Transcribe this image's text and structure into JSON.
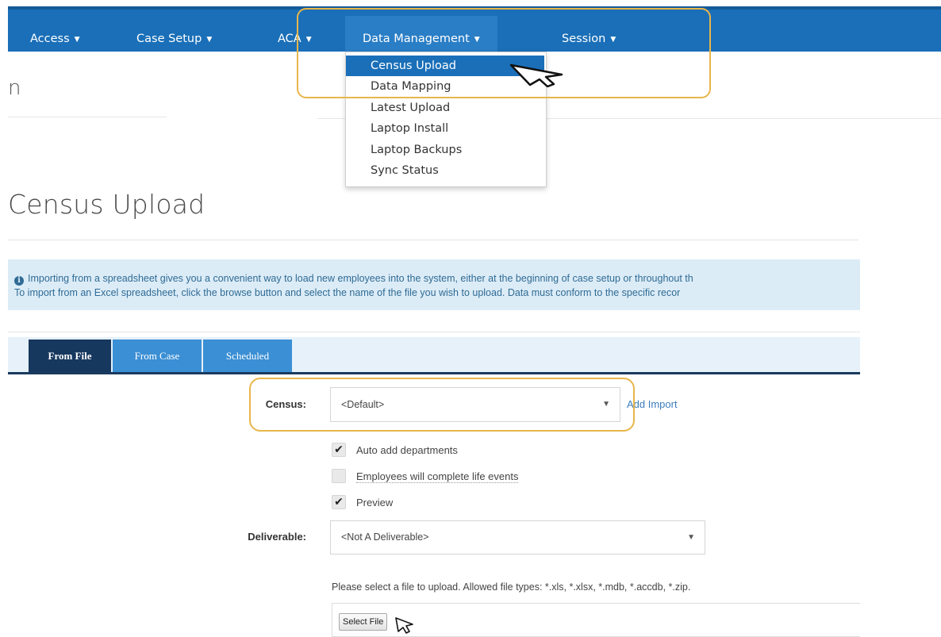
{
  "nav": {
    "items": [
      {
        "label": "Access",
        "caret": "▼"
      },
      {
        "label": "Case Setup",
        "caret": "▼"
      },
      {
        "label": "ACA",
        "caret": "▼"
      },
      {
        "label": "Data Management",
        "caret": "▼"
      },
      {
        "label": "Session",
        "caret": "▼"
      }
    ],
    "bar_color": "#1a6fb8",
    "active_item": "Data Management"
  },
  "dropdown": {
    "items": [
      {
        "label": "Census Upload",
        "highlighted": true
      },
      {
        "label": "Data Mapping"
      },
      {
        "label": "Latest Upload"
      },
      {
        "label": "Laptop Install"
      },
      {
        "label": "Laptop Backups"
      },
      {
        "label": "Sync Status"
      }
    ]
  },
  "background_page": {
    "heading_fragment": "n"
  },
  "page": {
    "title": "Census Upload",
    "info": {
      "icon": "info-circle-icon",
      "line1": "Importing from a spreadsheet gives you a convenient way to load new employees into the system, either at the beginning of case setup or throughout th",
      "line2": "To import from an Excel spreadsheet, click the browse button and select the name of the file you wish to upload. Data must conform to the specific recor"
    },
    "tabs": [
      {
        "label": "From File",
        "active": true
      },
      {
        "label": "From Case",
        "active": false
      },
      {
        "label": "Scheduled",
        "active": false
      }
    ],
    "form": {
      "census_label": "Census:",
      "census_value": "<Default>",
      "add_import_label": "Add Import",
      "checkboxes": [
        {
          "label": "Auto add departments",
          "checked": true
        },
        {
          "label": "Employees will complete life events",
          "checked": false
        },
        {
          "label": "Preview",
          "checked": true
        }
      ],
      "deliverable_label": "Deliverable:",
      "deliverable_value": "<Not A Deliverable>",
      "upload_hint": "Please select a file to upload. Allowed file types: *.xls, *.xlsx, *.mdb, *.accdb, *.zip.",
      "select_file_label": "Select File"
    }
  },
  "colors": {
    "highlight_box": "#e8b64a",
    "tab_active": "#17385e",
    "tab_inactive": "#3b8fd4",
    "info_bg": "#dcecf7"
  }
}
